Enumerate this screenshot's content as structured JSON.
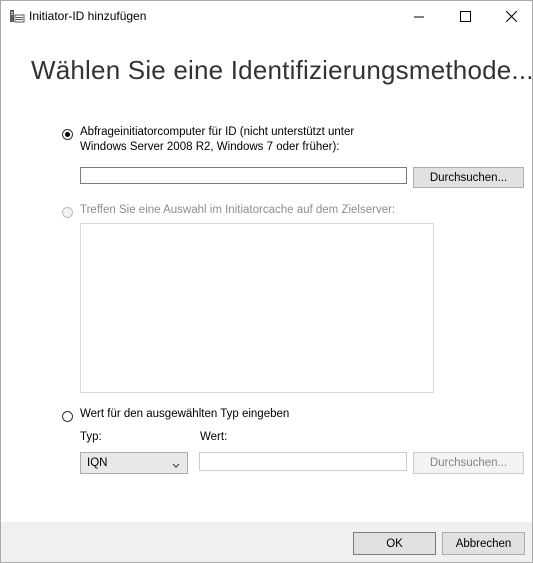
{
  "window": {
    "title": "Initiator-ID hinzufügen",
    "icons": {
      "app": "server-initiator-icon",
      "minimize": "minimize-icon",
      "maximize": "maximize-icon",
      "close": "close-icon"
    }
  },
  "heading": "Wählen Sie eine Identifizierungsmethode...",
  "option_query": {
    "label_line1": "Abfrageinitiatorcomputer für ID (nicht unterstützt unter",
    "label_line2": "Windows Server 2008 R2, Windows 7 oder früher):",
    "selected": true,
    "input_value": "",
    "browse_label": "Durchsuchen..."
  },
  "option_cache": {
    "label": "Treffen Sie eine Auswahl im Initiatorcache auf dem Zielserver:",
    "selected": false,
    "enabled": false,
    "items": []
  },
  "option_manual": {
    "label": "Wert für den ausgewählten Typ eingeben",
    "selected": false,
    "type_label": "Typ:",
    "value_label": "Wert:",
    "type_value": "IQN",
    "value_input": "",
    "browse_label": "Durchsuchen..."
  },
  "footer": {
    "ok_label": "OK",
    "cancel_label": "Abbrechen"
  }
}
